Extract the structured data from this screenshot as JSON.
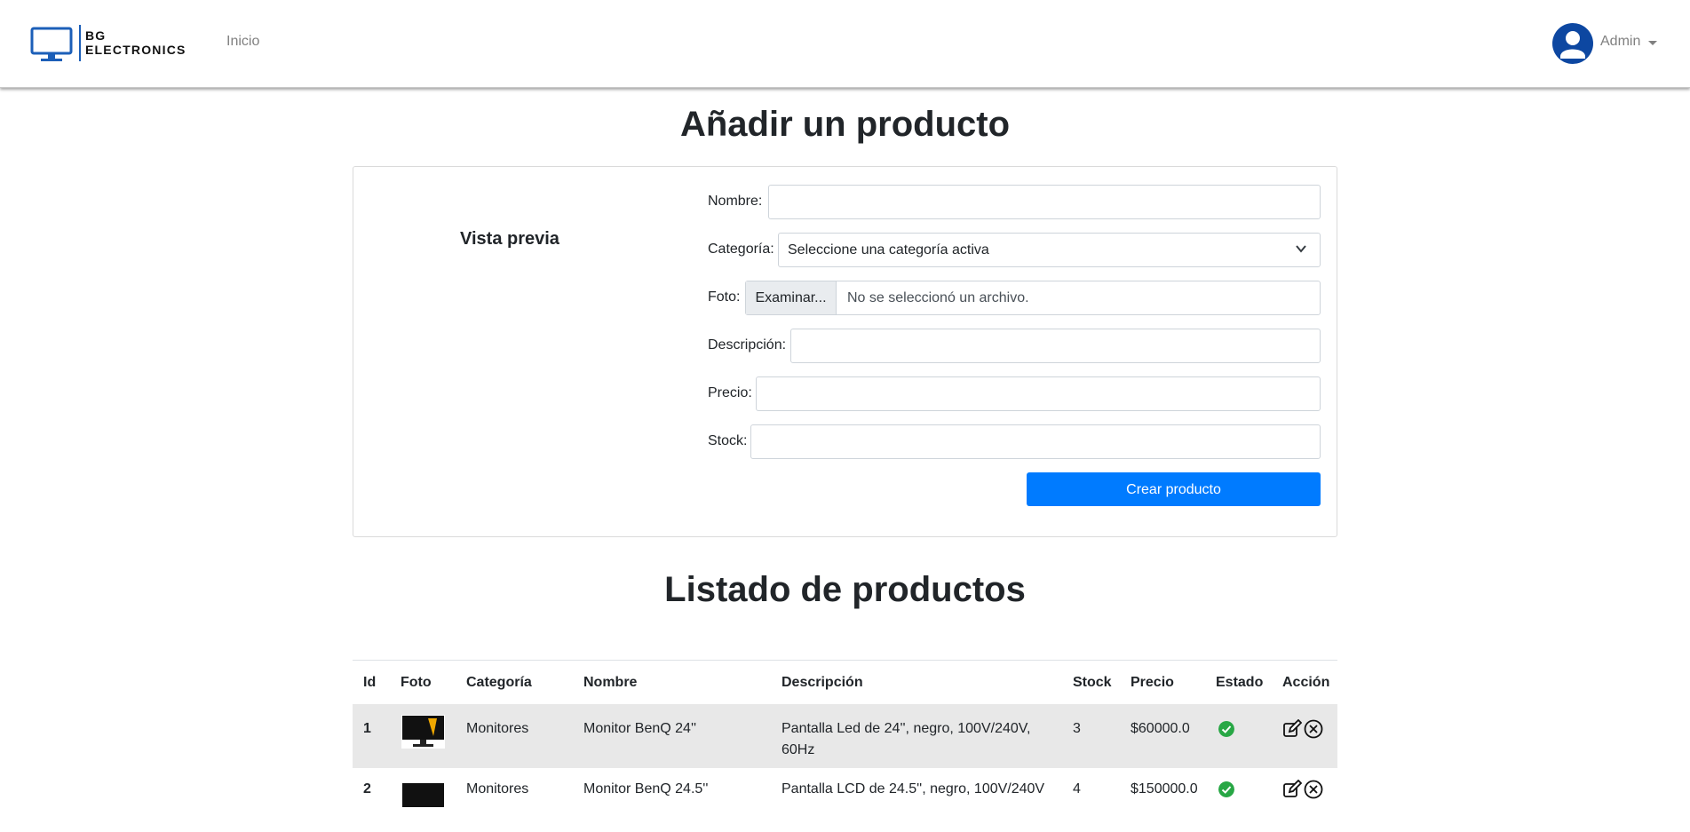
{
  "brand": {
    "line1": "BG",
    "line2": "ELECTRONICS",
    "accent": "#1c5fb8"
  },
  "nav": {
    "inicio": "Inicio"
  },
  "user": {
    "name": "Admin",
    "avatar_color": "#0d47a1"
  },
  "form": {
    "title": "Añadir un producto",
    "preview_label": "Vista previa",
    "nombre_label": "Nombre:",
    "categoria_label": "Categoría:",
    "categoria_selected": "Seleccione una categoría activa",
    "foto_label": "Foto:",
    "foto_button": "Examinar...",
    "foto_text": "No se seleccionó un archivo.",
    "descripcion_label": "Descripción:",
    "precio_label": "Precio:",
    "stock_label": "Stock:",
    "submit": "Crear producto",
    "submit_color": "#007bff"
  },
  "list": {
    "title": "Listado de productos",
    "columns": [
      "Id",
      "Foto",
      "Categoría",
      "Nombre",
      "Descripción",
      "Stock",
      "Precio",
      "Estado",
      "Acción"
    ],
    "rows": [
      {
        "id": "1",
        "categoria": "Monitores",
        "nombre": "Monitor BenQ 24''",
        "descripcion_1": "Pantalla Led de 24'', negro, 100V/240V,",
        "descripcion_2": "60Hz",
        "stock": "3",
        "precio": "$60000.0",
        "estado": "activo"
      },
      {
        "id": "2",
        "categoria": "Monitores",
        "nombre": "Monitor BenQ 24.5''",
        "descripcion_1": "Pantalla LCD de 24.5'', negro, 100V/240V",
        "descripcion_2": "",
        "stock": "4",
        "precio": "$150000.0",
        "estado": "activo"
      }
    ]
  }
}
